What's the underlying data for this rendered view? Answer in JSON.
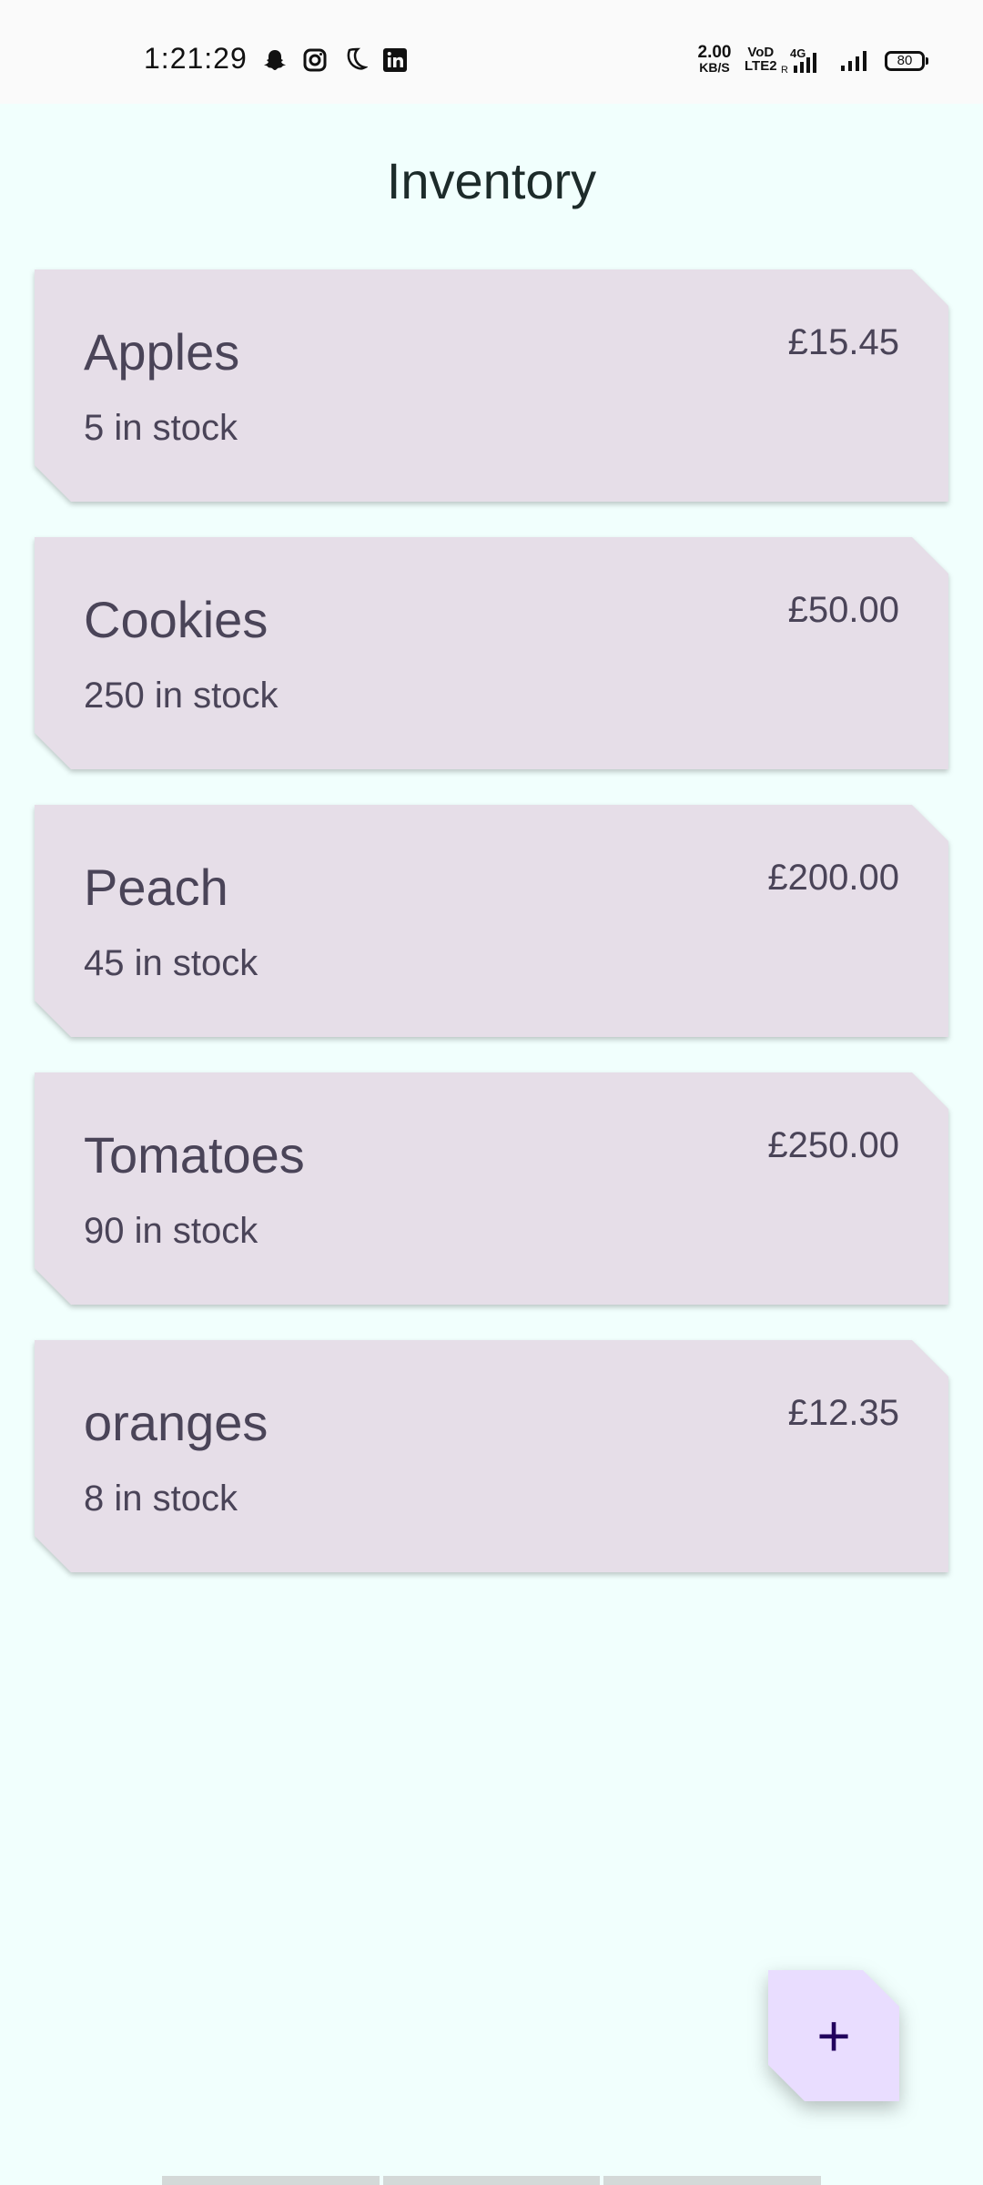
{
  "status_bar": {
    "time": "1:21:29",
    "net_speed": "2.00",
    "net_speed_unit": "KB/S",
    "volte_top": "VoD",
    "volte_bottom": "LTE2",
    "network_type": "4G",
    "battery": "80",
    "icons": [
      "snapchat-icon",
      "instagram-icon",
      "moon-icon",
      "linkedin-icon",
      "signal-icon",
      "signal-icon",
      "battery-icon"
    ]
  },
  "title": "Inventory",
  "items": [
    {
      "name": "Apples",
      "stock": "5 in stock",
      "price": "£15.45"
    },
    {
      "name": "Cookies",
      "stock": "250 in stock",
      "price": "£50.00"
    },
    {
      "name": "Peach",
      "stock": "45 in stock",
      "price": "£200.00"
    },
    {
      "name": "Tomatoes",
      "stock": "90 in stock",
      "price": "£250.00"
    },
    {
      "name": "oranges",
      "stock": "8 in stock",
      "price": "£12.35"
    }
  ],
  "fab": {
    "label": "+",
    "icon": "add-icon"
  },
  "colors": {
    "background": "#F1FFFD",
    "card": "#E6DEE8",
    "fab": "#E9DDFF",
    "text": "#4A4458"
  }
}
